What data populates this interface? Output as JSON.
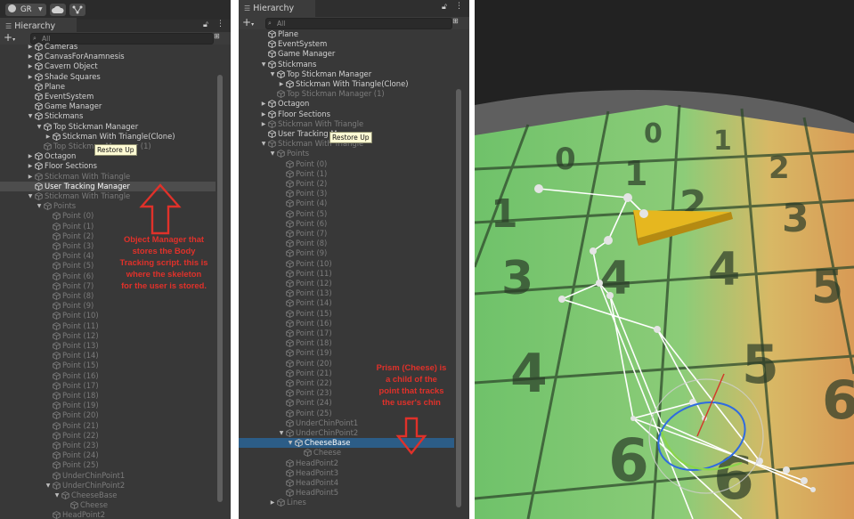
{
  "colors": {
    "selected_row": "#4d4d4d",
    "highlight_row": "#2c5d87",
    "annotation": "#e0312a",
    "tooltip_bg": "#fffbd4"
  },
  "toolbar": {
    "account": "GR",
    "account_icon": "account-icon",
    "cloud_icon": "cloud-icon",
    "settings_icon": "collab-icon"
  },
  "hierarchy_tab": {
    "label": "Hierarchy",
    "lock_icon": "lock-icon",
    "menu_icon": "kebab-menu-icon"
  },
  "search": {
    "placeholder": "All",
    "add_label": "+"
  },
  "tooltip": {
    "text": "Restore Up"
  },
  "left_panel": {
    "rows": [
      {
        "label": "Cameras",
        "indent": 0,
        "arrow": "right",
        "dim": false
      },
      {
        "label": "CanvasForAnamnesis",
        "indent": 0,
        "arrow": "right",
        "dim": false
      },
      {
        "label": "Cavern Object",
        "indent": 0,
        "arrow": "right",
        "dim": false
      },
      {
        "label": "Shade Squares",
        "indent": 0,
        "arrow": "right",
        "dim": false
      },
      {
        "label": "Plane",
        "indent": 0,
        "arrow": "",
        "dim": false
      },
      {
        "label": "EventSystem",
        "indent": 0,
        "arrow": "",
        "dim": false
      },
      {
        "label": "Game Manager",
        "indent": 0,
        "arrow": "",
        "dim": false
      },
      {
        "label": "Stickmans",
        "indent": 0,
        "arrow": "down",
        "dim": false
      },
      {
        "label": "Top Stickman Manager",
        "indent": 1,
        "arrow": "down",
        "dim": false
      },
      {
        "label": "Stickman With Triangle(Clone)",
        "indent": 2,
        "arrow": "right",
        "dim": false
      },
      {
        "label": "Top Stickman Manager (1)",
        "indent": 1,
        "arrow": "",
        "dim": true
      },
      {
        "label": "Octagon",
        "indent": 0,
        "arrow": "right",
        "dim": false
      },
      {
        "label": "Floor Sections",
        "indent": 0,
        "arrow": "right",
        "dim": false
      },
      {
        "label": "Stickman With Triangle",
        "indent": 0,
        "arrow": "right",
        "dim": true
      },
      {
        "label": "User Tracking Manager",
        "indent": 0,
        "arrow": "",
        "dim": false,
        "selected": true
      },
      {
        "label": "Stickman With Triangle",
        "indent": 0,
        "arrow": "down",
        "dim": true
      },
      {
        "label": "Points",
        "indent": 1,
        "arrow": "down",
        "dim": true
      },
      {
        "label": "Point (0)",
        "indent": 2,
        "arrow": "",
        "dim": true
      },
      {
        "label": "Point (1)",
        "indent": 2,
        "arrow": "",
        "dim": true
      },
      {
        "label": "Point (2)",
        "indent": 2,
        "arrow": "",
        "dim": true
      },
      {
        "label": "Point (3)",
        "indent": 2,
        "arrow": "",
        "dim": true
      },
      {
        "label": "Point (4)",
        "indent": 2,
        "arrow": "",
        "dim": true
      },
      {
        "label": "Point (5)",
        "indent": 2,
        "arrow": "",
        "dim": true
      },
      {
        "label": "Point (6)",
        "indent": 2,
        "arrow": "",
        "dim": true
      },
      {
        "label": "Point (7)",
        "indent": 2,
        "arrow": "",
        "dim": true
      },
      {
        "label": "Point (8)",
        "indent": 2,
        "arrow": "",
        "dim": true
      },
      {
        "label": "Point (9)",
        "indent": 2,
        "arrow": "",
        "dim": true
      },
      {
        "label": "Point (10)",
        "indent": 2,
        "arrow": "",
        "dim": true
      },
      {
        "label": "Point (11)",
        "indent": 2,
        "arrow": "",
        "dim": true
      },
      {
        "label": "Point (12)",
        "indent": 2,
        "arrow": "",
        "dim": true
      },
      {
        "label": "Point (13)",
        "indent": 2,
        "arrow": "",
        "dim": true
      },
      {
        "label": "Point (14)",
        "indent": 2,
        "arrow": "",
        "dim": true
      },
      {
        "label": "Point (15)",
        "indent": 2,
        "arrow": "",
        "dim": true
      },
      {
        "label": "Point (16)",
        "indent": 2,
        "arrow": "",
        "dim": true
      },
      {
        "label": "Point (17)",
        "indent": 2,
        "arrow": "",
        "dim": true
      },
      {
        "label": "Point (18)",
        "indent": 2,
        "arrow": "",
        "dim": true
      },
      {
        "label": "Point (19)",
        "indent": 2,
        "arrow": "",
        "dim": true
      },
      {
        "label": "Point (20)",
        "indent": 2,
        "arrow": "",
        "dim": true
      },
      {
        "label": "Point (21)",
        "indent": 2,
        "arrow": "",
        "dim": true
      },
      {
        "label": "Point (22)",
        "indent": 2,
        "arrow": "",
        "dim": true
      },
      {
        "label": "Point (23)",
        "indent": 2,
        "arrow": "",
        "dim": true
      },
      {
        "label": "Point (24)",
        "indent": 2,
        "arrow": "",
        "dim": true
      },
      {
        "label": "Point (25)",
        "indent": 2,
        "arrow": "",
        "dim": true
      },
      {
        "label": "UnderChinPoint1",
        "indent": 2,
        "arrow": "",
        "dim": true
      },
      {
        "label": "UnderChinPoint2",
        "indent": 2,
        "arrow": "down",
        "dim": true
      },
      {
        "label": "CheeseBase",
        "indent": 3,
        "arrow": "down",
        "dim": true
      },
      {
        "label": "Cheese",
        "indent": 4,
        "arrow": "",
        "dim": true
      },
      {
        "label": "HeadPoint2",
        "indent": 2,
        "arrow": "",
        "dim": true
      }
    ]
  },
  "right_panel": {
    "rows": [
      {
        "label": "Plane",
        "indent": 0,
        "arrow": "",
        "dim": false
      },
      {
        "label": "EventSystem",
        "indent": 0,
        "arrow": "",
        "dim": false
      },
      {
        "label": "Game Manager",
        "indent": 0,
        "arrow": "",
        "dim": false
      },
      {
        "label": "Stickmans",
        "indent": 0,
        "arrow": "down",
        "dim": false
      },
      {
        "label": "Top Stickman Manager",
        "indent": 1,
        "arrow": "down",
        "dim": false
      },
      {
        "label": "Stickman With Triangle(Clone)",
        "indent": 2,
        "arrow": "right",
        "dim": false
      },
      {
        "label": "Top Stickman Manager (1)",
        "indent": 1,
        "arrow": "",
        "dim": true
      },
      {
        "label": "Octagon",
        "indent": 0,
        "arrow": "right",
        "dim": false
      },
      {
        "label": "Floor Sections",
        "indent": 0,
        "arrow": "right",
        "dim": false
      },
      {
        "label": "Stickman With Triangle",
        "indent": 0,
        "arrow": "right",
        "dim": true
      },
      {
        "label": "User Tracking Manager",
        "indent": 0,
        "arrow": "",
        "dim": false
      },
      {
        "label": "Stickman With Triangle",
        "indent": 0,
        "arrow": "down",
        "dim": true
      },
      {
        "label": "Points",
        "indent": 1,
        "arrow": "down",
        "dim": true
      },
      {
        "label": "Point (0)",
        "indent": 2,
        "arrow": "",
        "dim": true
      },
      {
        "label": "Point (1)",
        "indent": 2,
        "arrow": "",
        "dim": true
      },
      {
        "label": "Point (2)",
        "indent": 2,
        "arrow": "",
        "dim": true
      },
      {
        "label": "Point (3)",
        "indent": 2,
        "arrow": "",
        "dim": true
      },
      {
        "label": "Point (4)",
        "indent": 2,
        "arrow": "",
        "dim": true
      },
      {
        "label": "Point (5)",
        "indent": 2,
        "arrow": "",
        "dim": true
      },
      {
        "label": "Point (6)",
        "indent": 2,
        "arrow": "",
        "dim": true
      },
      {
        "label": "Point (7)",
        "indent": 2,
        "arrow": "",
        "dim": true
      },
      {
        "label": "Point (8)",
        "indent": 2,
        "arrow": "",
        "dim": true
      },
      {
        "label": "Point (9)",
        "indent": 2,
        "arrow": "",
        "dim": true
      },
      {
        "label": "Point (10)",
        "indent": 2,
        "arrow": "",
        "dim": true
      },
      {
        "label": "Point (11)",
        "indent": 2,
        "arrow": "",
        "dim": true
      },
      {
        "label": "Point (12)",
        "indent": 2,
        "arrow": "",
        "dim": true
      },
      {
        "label": "Point (13)",
        "indent": 2,
        "arrow": "",
        "dim": true
      },
      {
        "label": "Point (14)",
        "indent": 2,
        "arrow": "",
        "dim": true
      },
      {
        "label": "Point (15)",
        "indent": 2,
        "arrow": "",
        "dim": true
      },
      {
        "label": "Point (16)",
        "indent": 2,
        "arrow": "",
        "dim": true
      },
      {
        "label": "Point (17)",
        "indent": 2,
        "arrow": "",
        "dim": true
      },
      {
        "label": "Point (18)",
        "indent": 2,
        "arrow": "",
        "dim": true
      },
      {
        "label": "Point (19)",
        "indent": 2,
        "arrow": "",
        "dim": true
      },
      {
        "label": "Point (20)",
        "indent": 2,
        "arrow": "",
        "dim": true
      },
      {
        "label": "Point (21)",
        "indent": 2,
        "arrow": "",
        "dim": true
      },
      {
        "label": "Point (22)",
        "indent": 2,
        "arrow": "",
        "dim": true
      },
      {
        "label": "Point (23)",
        "indent": 2,
        "arrow": "",
        "dim": true
      },
      {
        "label": "Point (24)",
        "indent": 2,
        "arrow": "",
        "dim": true
      },
      {
        "label": "Point (25)",
        "indent": 2,
        "arrow": "",
        "dim": true
      },
      {
        "label": "UnderChinPoint1",
        "indent": 2,
        "arrow": "",
        "dim": true
      },
      {
        "label": "UnderChinPoint2",
        "indent": 2,
        "arrow": "down",
        "dim": true
      },
      {
        "label": "CheeseBase",
        "indent": 3,
        "arrow": "down",
        "dim": false,
        "highlight": true
      },
      {
        "label": "Cheese",
        "indent": 4,
        "arrow": "",
        "dim": true
      },
      {
        "label": "HeadPoint2",
        "indent": 2,
        "arrow": "",
        "dim": true
      },
      {
        "label": "HeadPoint3",
        "indent": 2,
        "arrow": "",
        "dim": true
      },
      {
        "label": "HeadPoint4",
        "indent": 2,
        "arrow": "",
        "dim": true
      },
      {
        "label": "HeadPoint5",
        "indent": 2,
        "arrow": "",
        "dim": true
      },
      {
        "label": "Lines",
        "indent": 1,
        "arrow": "right",
        "dim": true
      }
    ]
  },
  "annotations": {
    "left_lines": [
      "Object Manager that",
      "stores the Body",
      "Tracking script. this is",
      "where the skeleton",
      "for the user is stored."
    ],
    "right_lines": [
      "Prism (Cheese) is",
      "a child of the",
      "point that tracks",
      "the user's chin"
    ]
  },
  "scene": {
    "grid_numbers": [
      "0",
      "1",
      "2",
      "0",
      "1",
      "2",
      "1",
      "2",
      "3",
      "3",
      "4",
      "5",
      "4",
      "5",
      "6",
      "5",
      "6"
    ]
  }
}
